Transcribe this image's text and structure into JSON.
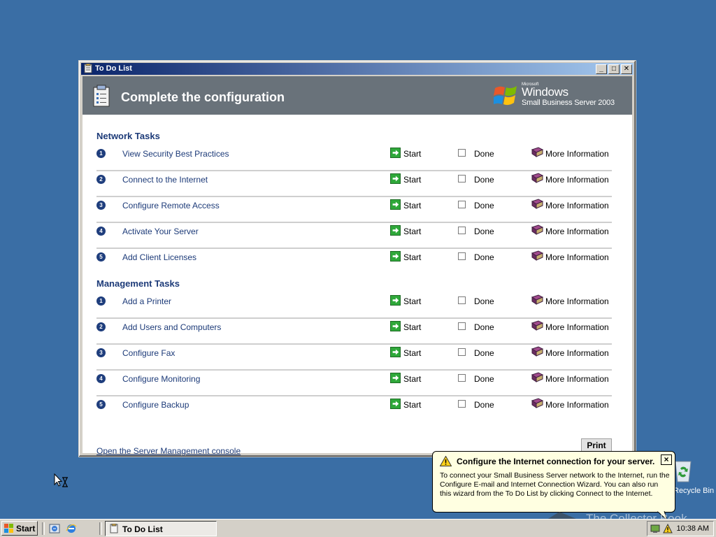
{
  "window": {
    "title": "To Do List",
    "header_title": "Complete the configuration",
    "logo": {
      "microsoft": "Microsoft",
      "windows": "Windows",
      "product": "Small Business Server 2003"
    }
  },
  "labels": {
    "start": "Start",
    "done": "Done",
    "more_info": "More Information"
  },
  "sections": [
    {
      "title": "Network Tasks",
      "tasks": [
        {
          "num": "1",
          "label": "View Security Best Practices",
          "done": false
        },
        {
          "num": "2",
          "label": "Connect to the Internet",
          "done": false
        },
        {
          "num": "3",
          "label": "Configure Remote Access",
          "done": false
        },
        {
          "num": "4",
          "label": "Activate Your Server",
          "done": false
        },
        {
          "num": "5",
          "label": "Add Client Licenses",
          "done": false
        }
      ]
    },
    {
      "title": "Management Tasks",
      "tasks": [
        {
          "num": "1",
          "label": "Add a Printer",
          "done": false
        },
        {
          "num": "2",
          "label": "Add Users and Computers",
          "done": false
        },
        {
          "num": "3",
          "label": "Configure Fax",
          "done": false
        },
        {
          "num": "4",
          "label": "Configure Monitoring",
          "done": false
        },
        {
          "num": "5",
          "label": "Configure Backup",
          "done": false
        }
      ]
    }
  ],
  "footer": {
    "console_link": "Open the Server Management console",
    "print_label": "Print"
  },
  "balloon": {
    "title": "Configure the Internet connection for your server.",
    "text": "To connect your Small Business Server network to the Internet, run the Configure E-mail and Internet Connection Wizard. You can also run this wizard from the To Do List by clicking Connect to the Internet.",
    "close": "×"
  },
  "desktop": {
    "recycle_bin_label": "Recycle Bin"
  },
  "watermark": {
    "text": "The Collector Book"
  },
  "taskbar": {
    "start_label": "Start",
    "task_label": "To Do List",
    "clock": "10:38 AM"
  },
  "colors": {
    "desktop": "#3a6ea5",
    "header": "#69727a",
    "link": "#1c3a78",
    "titlebar_start": "#0a246a"
  },
  "icons": {
    "start_arrow": "green-arrow-icon",
    "more_info": "book-icon",
    "balloon": "warning-icon",
    "header": "clipboard-icon"
  }
}
